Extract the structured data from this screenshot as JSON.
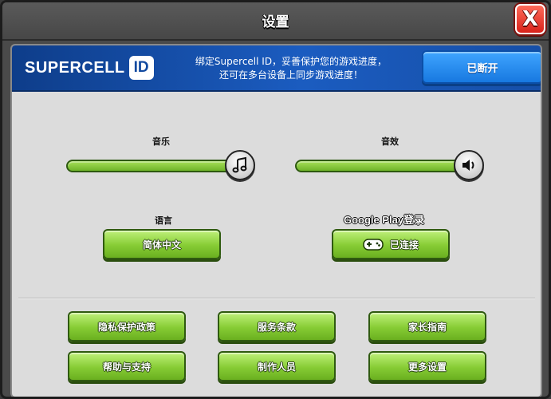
{
  "window": {
    "title": "设置",
    "close_icon": "X"
  },
  "supercell": {
    "logo_text": "SUPERCELL",
    "logo_badge": "ID",
    "desc_line1": "绑定Supercell ID，妥善保护您的游戏进度，",
    "desc_line2": "还可在多台设备上同步游戏进度！",
    "button": "已断开",
    "accent": "#1b5cc0"
  },
  "audio": {
    "music_label": "音乐",
    "music_level": 1.0,
    "music_icon": "music-note-icon",
    "sfx_label": "音效",
    "sfx_level": 1.0,
    "sfx_icon": "speaker-icon"
  },
  "language": {
    "label": "语言",
    "button": "简体中文"
  },
  "google_play": {
    "label": "Google Play登录",
    "button": "已连接",
    "icon": "gamepad-icon"
  },
  "buttons": {
    "privacy": "隐私保护政策",
    "terms": "服务条款",
    "parents": "家长指南",
    "help": "帮助与支持",
    "credits": "制作人员",
    "more": "更多设置"
  },
  "colors": {
    "button_green": "#86cc34",
    "close_red": "#d8221a",
    "panel_bg": "#dcdcdc"
  }
}
